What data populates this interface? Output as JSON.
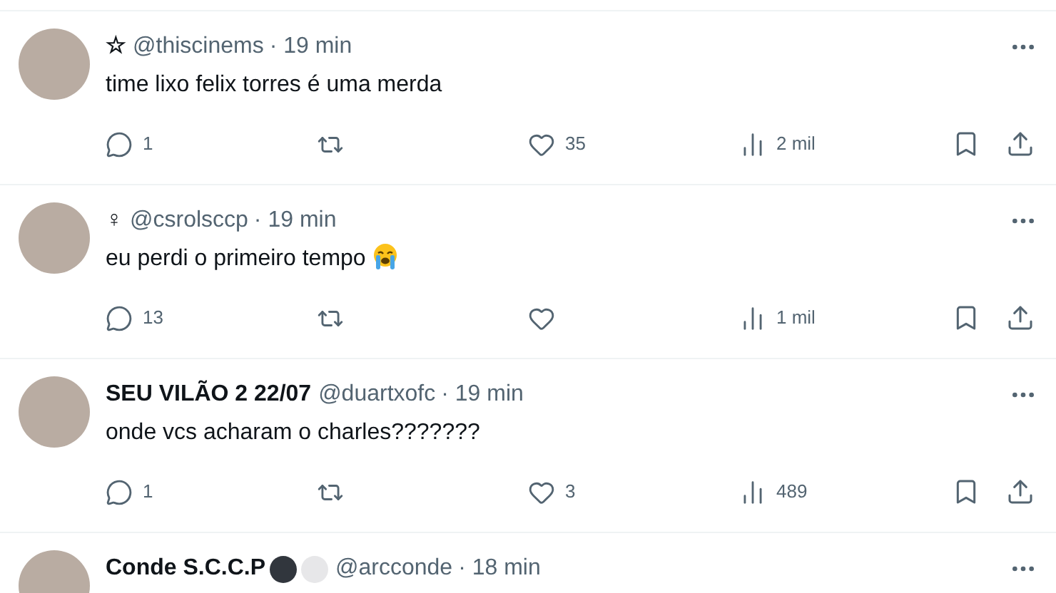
{
  "tweets": [
    {
      "name": "☆",
      "handle": "@thiscinems",
      "separator": "·",
      "time": "19 min",
      "text": "time lixo felix torres é uma merda",
      "replies": "1",
      "likes": "35",
      "views": "2 mil"
    },
    {
      "name": "♀",
      "handle": "@csrolsccp",
      "separator": "·",
      "time": "19 min",
      "text": "eu perdi o primeiro tempo",
      "emoji": {
        "kind": "crying"
      },
      "replies": "13",
      "views": "1 mil"
    },
    {
      "name": "SEU VILÃO 2 22/07",
      "handle": "@duartxofc",
      "separator": "·",
      "time": "19 min",
      "text": "onde vcs acharam o charles???????",
      "replies": "1",
      "likes": "3",
      "views": "489"
    },
    {
      "name": "Conde S.C.C.P",
      "badges": [
        {
          "color": "#31363d"
        },
        {
          "color": "#e7e7e9"
        }
      ],
      "handle": "@arcconde",
      "separator": "·",
      "time": "18 min"
    }
  ]
}
